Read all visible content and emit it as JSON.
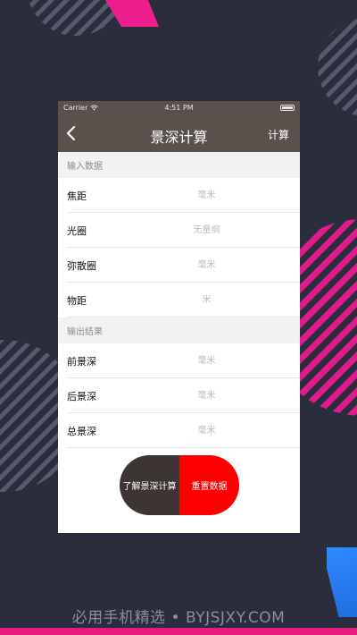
{
  "status_bar": {
    "carrier": "Carrier",
    "time": "4:51 PM"
  },
  "nav": {
    "title": "景深计算",
    "action": "计算"
  },
  "input_section": {
    "header": "输入数据",
    "rows": [
      {
        "label": "焦距",
        "placeholder": "毫米"
      },
      {
        "label": "光圈",
        "placeholder": "无量纲"
      },
      {
        "label": "弥散圈",
        "placeholder": "毫米"
      },
      {
        "label": "物距",
        "placeholder": "米"
      }
    ]
  },
  "output_section": {
    "header": "输出结果",
    "rows": [
      {
        "label": "前景深",
        "placeholder": "毫米"
      },
      {
        "label": "后景深",
        "placeholder": "毫米"
      },
      {
        "label": "总景深",
        "placeholder": "毫米"
      }
    ]
  },
  "buttons": {
    "learn": "了解景深计算",
    "reset": "重置数据"
  },
  "watermark": "必用手机精选 • BYJSJXY.COM",
  "colors": {
    "nav_bg": "#5a514d",
    "learn_btn": "#3d3533",
    "reset_btn": "#ff0000",
    "background": "#2a2d3b",
    "accent_pink": "#e8197f"
  }
}
